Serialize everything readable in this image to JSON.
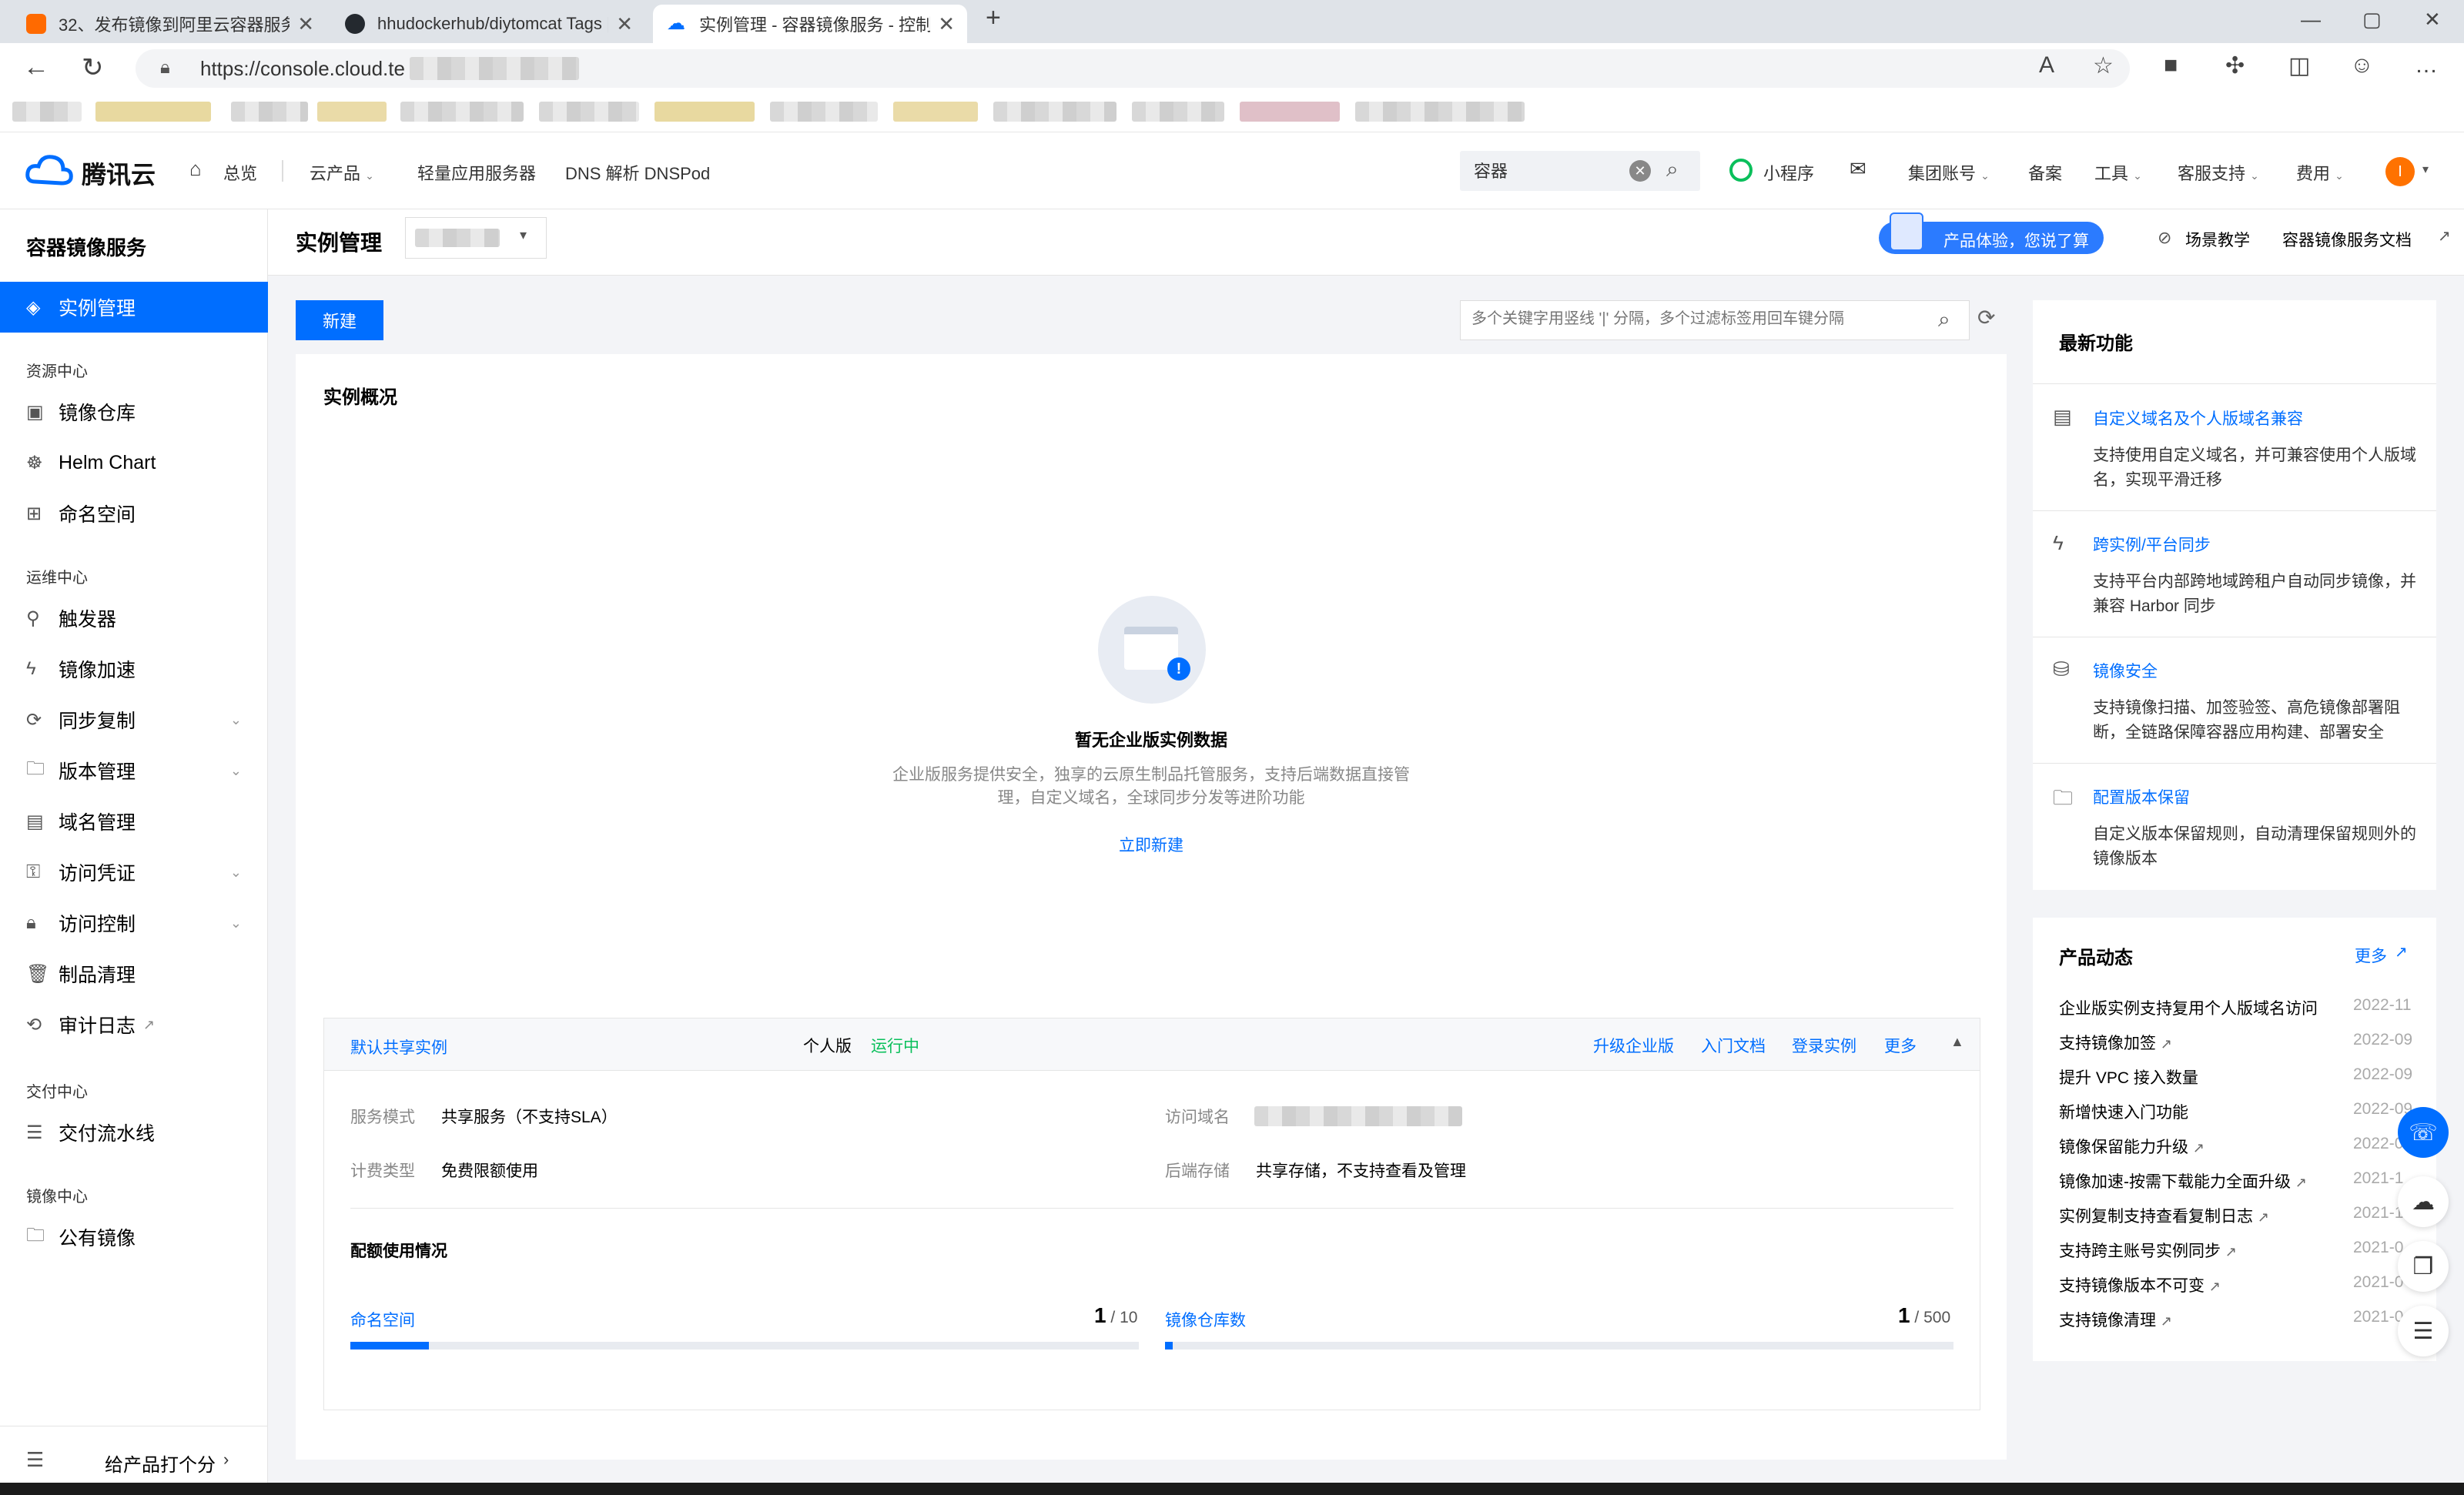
{
  "browser": {
    "tabs": [
      {
        "title": "32、发布镜像到阿里云容器服务..."
      },
      {
        "title": "hhudockerhub/diytomcat Tags | ..."
      },
      {
        "title": "实例管理 - 容器镜像服务 - 控制台"
      }
    ],
    "new_tab": "+",
    "url": "https://console.cloud.te",
    "window_controls": {
      "minimize": "—",
      "maximize": "▢",
      "close": "✕"
    }
  },
  "topnav": {
    "logo_text": "腾讯云",
    "home": "总览",
    "products": "云产品",
    "lighthouse": "轻量应用服务器",
    "dns": "DNS 解析 DNSPod",
    "search_value": "容器",
    "miniprogram": "小程序",
    "group_account": "集团账号",
    "beian": "备案",
    "tools": "工具",
    "support": "客服支持",
    "billing": "费用",
    "avatar_letter": "I"
  },
  "sidebar": {
    "title": "容器镜像服务",
    "active_item": "实例管理",
    "groups": [
      {
        "label": "资源中心",
        "items": [
          "镜像仓库",
          "Helm Chart",
          "命名空间"
        ]
      },
      {
        "label": "运维中心",
        "items": [
          "触发器",
          "镜像加速",
          "同步复制",
          "版本管理",
          "域名管理",
          "访问凭证",
          "访问控制",
          "制品清理",
          "审计日志"
        ]
      },
      {
        "label": "交付中心",
        "items": [
          "交付流水线"
        ]
      },
      {
        "label": "镜像中心",
        "items": [
          "公有镜像"
        ]
      }
    ],
    "footer_label": "给产品打个分"
  },
  "pagehead": {
    "title": "实例管理",
    "feedback_label": "产品体验，您说了算",
    "tutorial": "场景教学",
    "docs": "容器镜像服务文档"
  },
  "main": {
    "new_button": "新建",
    "search_placeholder": "多个关键字用竖线 '|' 分隔，多个过滤标签用回车键分隔",
    "overview_title": "实例概况",
    "empty_title": "暂无企业版实例数据",
    "empty_desc_1": "企业版服务提供安全，独享的云原生制品托管服务，支持后端数据直接管",
    "empty_desc_2": "理，自定义域名，全球同步分发等进阶功能",
    "create_now": "立即新建",
    "instance": {
      "name": "默认共享实例",
      "edition": "个人版",
      "status": "运行中",
      "actions": [
        "升级企业版",
        "入门文档",
        "登录实例",
        "更多"
      ],
      "service_mode_label": "服务模式",
      "service_mode": "共享服务（不支持SLA）",
      "billing_label": "计费类型",
      "billing": "免费限额使用",
      "domain_label": "访问域名",
      "storage_label": "后端存储",
      "storage": "共享存储，不支持查看及管理",
      "quota_title": "配额使用情况",
      "quotas": [
        {
          "label": "命名空间",
          "used": "1",
          "limit": " / 10",
          "fraction": 0.1
        },
        {
          "label": "镜像仓库数",
          "used": "1",
          "limit": " / 500",
          "fraction": 0.002
        }
      ]
    }
  },
  "features": {
    "title": "最新功能",
    "items": [
      {
        "title": "自定义域名及个人版域名兼容",
        "desc": "支持使用自定义域名，并可兼容使用个人版域名，实现平滑迁移",
        "icon": "calendar-icon"
      },
      {
        "title": "跨实例/平台同步",
        "desc": "支持平台内部跨地域跨租户自动同步镜像，并兼容 Harbor 同步",
        "icon": "lightning-icon"
      },
      {
        "title": "镜像安全",
        "desc": "支持镜像扫描、加签验签、高危镜像部署阻断，全链路保障容器应用构建、部署安全",
        "icon": "database-lock-icon"
      },
      {
        "title": "配置版本保留",
        "desc": "自定义版本保留规则，自动清理保留规则外的镜像版本",
        "icon": "folder-icon"
      }
    ]
  },
  "news": {
    "title": "产品动态",
    "more": "更多",
    "items": [
      {
        "text": "企业版实例支持复用个人版域名访问",
        "date": "2022-11",
        "ext": false
      },
      {
        "text": "支持镜像加签",
        "date": "2022-09",
        "ext": true
      },
      {
        "text": "提升 VPC 接入数量",
        "date": "2022-09",
        "ext": false
      },
      {
        "text": "新增快速入门功能",
        "date": "2022-09",
        "ext": false
      },
      {
        "text": "镜像保留能力升级",
        "date": "2022-0",
        "ext": true
      },
      {
        "text": "镜像加速-按需下载能力全面升级",
        "date": "2021-1",
        "ext": true
      },
      {
        "text": "实例复制支持查看复制日志",
        "date": "2021-1",
        "ext": true
      },
      {
        "text": "支持跨主账号实例同步",
        "date": "2021-0",
        "ext": true
      },
      {
        "text": "支持镜像版本不可变",
        "date": "2021-0",
        "ext": true
      },
      {
        "text": "支持镜像清理",
        "date": "2021-0",
        "ext": true
      }
    ]
  },
  "colors": {
    "primary": "#006eff",
    "success": "#0abf5b",
    "avatar": "#ff7200"
  }
}
